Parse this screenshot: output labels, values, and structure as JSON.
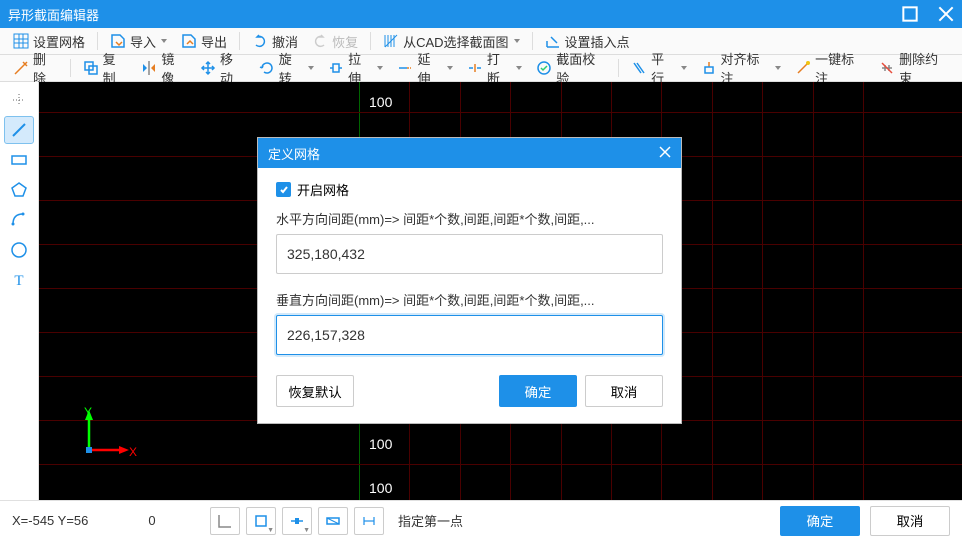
{
  "window": {
    "title": "异形截面编辑器"
  },
  "toolbar1": {
    "grid_settings": "设置网格",
    "import": "导入",
    "export": "导出",
    "undo": "撤消",
    "redo": "恢复",
    "from_cad": "从CAD选择截面图",
    "set_insert_point": "设置插入点"
  },
  "toolbar2": {
    "delete": "删除",
    "copy": "复制",
    "mirror": "镜像",
    "move": "移动",
    "rotate": "旋转",
    "stretch": "拉伸",
    "extend": "延伸",
    "break": "打断",
    "section_check": "截面校验",
    "parallel": "平行",
    "align_mark": "对齐标注",
    "one_key_mark": "一键标注",
    "delete_constraint": "删除约束"
  },
  "canvas": {
    "axis_label_100": "100"
  },
  "status": {
    "coords": "X=-545 Y=56",
    "zero": "0",
    "prompt": "指定第一点",
    "ok": "确定",
    "cancel": "取消"
  },
  "modal": {
    "title": "定义网格",
    "enable_grid": "开启网格",
    "h_label": "水平方向间距(mm)=> 间距*个数,间距,间距*个数,间距,...",
    "h_value": "325,180,432",
    "v_label": "垂直方向间距(mm)=> 间距*个数,间距,间距*个数,间距,...",
    "v_value": "226,157,328",
    "restore": "恢复默认",
    "ok": "确定",
    "cancel": "取消"
  },
  "colors": {
    "accent": "#1e90e8"
  }
}
